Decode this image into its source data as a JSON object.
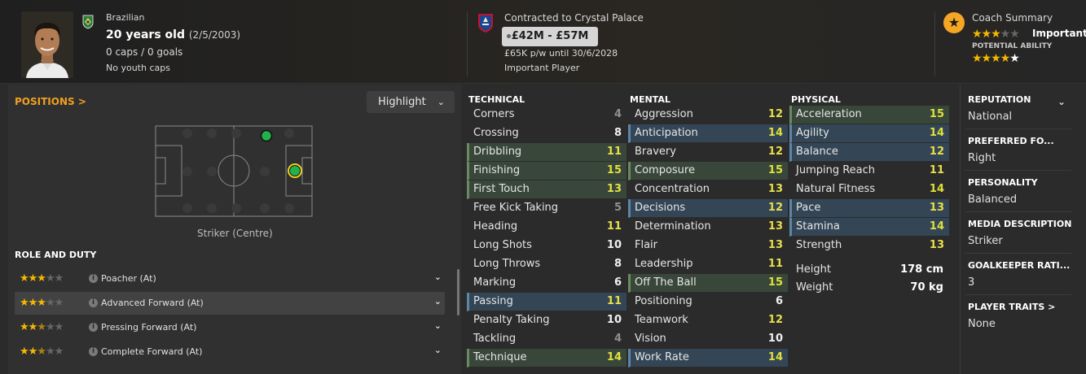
{
  "header": {
    "nationality": "Brazilian",
    "age": "20 years old",
    "dob": "(2/5/2003)",
    "caps": "0 caps / 0 goals",
    "youth_caps": "No youth caps",
    "contract": "Contracted to Crystal Palace",
    "value": "£42M - £57M",
    "wage": "£65K p/w until 30/6/2028",
    "squad_status": "Important Player",
    "coach_summary_label": "Coach Summary",
    "coach_summary_value": "Important p",
    "potential_label": "POTENTIAL ABILITY",
    "current_ability_stars": 3,
    "potential_ability_stars": 4.5
  },
  "positions": {
    "label": "POSITIONS >",
    "highlight_label": "Highlight",
    "position_name": "Striker (Centre)"
  },
  "roles": {
    "header": "ROLE AND DUTY",
    "items": [
      {
        "name": "Poacher (At)",
        "stars": 3
      },
      {
        "name": "Advanced Forward (At)",
        "stars": 3
      },
      {
        "name": "Pressing Forward (At)",
        "stars": 2.5
      },
      {
        "name": "Complete Forward (At)",
        "stars": 2.5
      }
    ]
  },
  "technical": {
    "header": "TECHNICAL",
    "attrs": [
      {
        "name": "Corners",
        "value": "4",
        "hl": ""
      },
      {
        "name": "Crossing",
        "value": "8",
        "hl": ""
      },
      {
        "name": "Dribbling",
        "value": "11",
        "hl": "g"
      },
      {
        "name": "Finishing",
        "value": "15",
        "hl": "g"
      },
      {
        "name": "First Touch",
        "value": "13",
        "hl": "g"
      },
      {
        "name": "Free Kick Taking",
        "value": "5",
        "hl": ""
      },
      {
        "name": "Heading",
        "value": "11",
        "hl": ""
      },
      {
        "name": "Long Shots",
        "value": "10",
        "hl": ""
      },
      {
        "name": "Long Throws",
        "value": "8",
        "hl": ""
      },
      {
        "name": "Marking",
        "value": "6",
        "hl": ""
      },
      {
        "name": "Passing",
        "value": "11",
        "hl": "b"
      },
      {
        "name": "Penalty Taking",
        "value": "10",
        "hl": ""
      },
      {
        "name": "Tackling",
        "value": "4",
        "hl": ""
      },
      {
        "name": "Technique",
        "value": "14",
        "hl": "g"
      }
    ]
  },
  "mental": {
    "header": "MENTAL",
    "attrs": [
      {
        "name": "Aggression",
        "value": "12",
        "hl": ""
      },
      {
        "name": "Anticipation",
        "value": "14",
        "hl": "b"
      },
      {
        "name": "Bravery",
        "value": "12",
        "hl": ""
      },
      {
        "name": "Composure",
        "value": "15",
        "hl": "g"
      },
      {
        "name": "Concentration",
        "value": "13",
        "hl": ""
      },
      {
        "name": "Decisions",
        "value": "12",
        "hl": "b"
      },
      {
        "name": "Determination",
        "value": "13",
        "hl": ""
      },
      {
        "name": "Flair",
        "value": "13",
        "hl": ""
      },
      {
        "name": "Leadership",
        "value": "11",
        "hl": ""
      },
      {
        "name": "Off The Ball",
        "value": "15",
        "hl": "g"
      },
      {
        "name": "Positioning",
        "value": "6",
        "hl": ""
      },
      {
        "name": "Teamwork",
        "value": "12",
        "hl": ""
      },
      {
        "name": "Vision",
        "value": "10",
        "hl": ""
      },
      {
        "name": "Work Rate",
        "value": "14",
        "hl": "b"
      }
    ]
  },
  "physical": {
    "header": "PHYSICAL",
    "attrs": [
      {
        "name": "Acceleration",
        "value": "15",
        "hl": "g"
      },
      {
        "name": "Agility",
        "value": "14",
        "hl": "b"
      },
      {
        "name": "Balance",
        "value": "12",
        "hl": "b"
      },
      {
        "name": "Jumping Reach",
        "value": "11",
        "hl": ""
      },
      {
        "name": "Natural Fitness",
        "value": "14",
        "hl": ""
      },
      {
        "name": "Pace",
        "value": "13",
        "hl": "b"
      },
      {
        "name": "Stamina",
        "value": "14",
        "hl": "b"
      },
      {
        "name": "Strength",
        "value": "13",
        "hl": ""
      }
    ],
    "height_label": "Height",
    "height_value": "178 cm",
    "weight_label": "Weight",
    "weight_value": "70 kg"
  },
  "info": {
    "reputation_label": "REPUTATION",
    "reputation_value": "National",
    "foot_label": "PREFERRED FO...",
    "foot_value": "Right",
    "personality_label": "PERSONALITY",
    "personality_value": "Balanced",
    "media_label": "MEDIA DESCRIPTION",
    "media_value": "Striker",
    "gk_label": "GOALKEEPER RATI...",
    "gk_value": "3",
    "traits_label": "PLAYER TRAITS >",
    "traits_value": "None"
  },
  "colors": {
    "accent": "#f0a020",
    "star": "#f5b800",
    "green_hl": "#39473a",
    "blue_hl": "#344656"
  }
}
